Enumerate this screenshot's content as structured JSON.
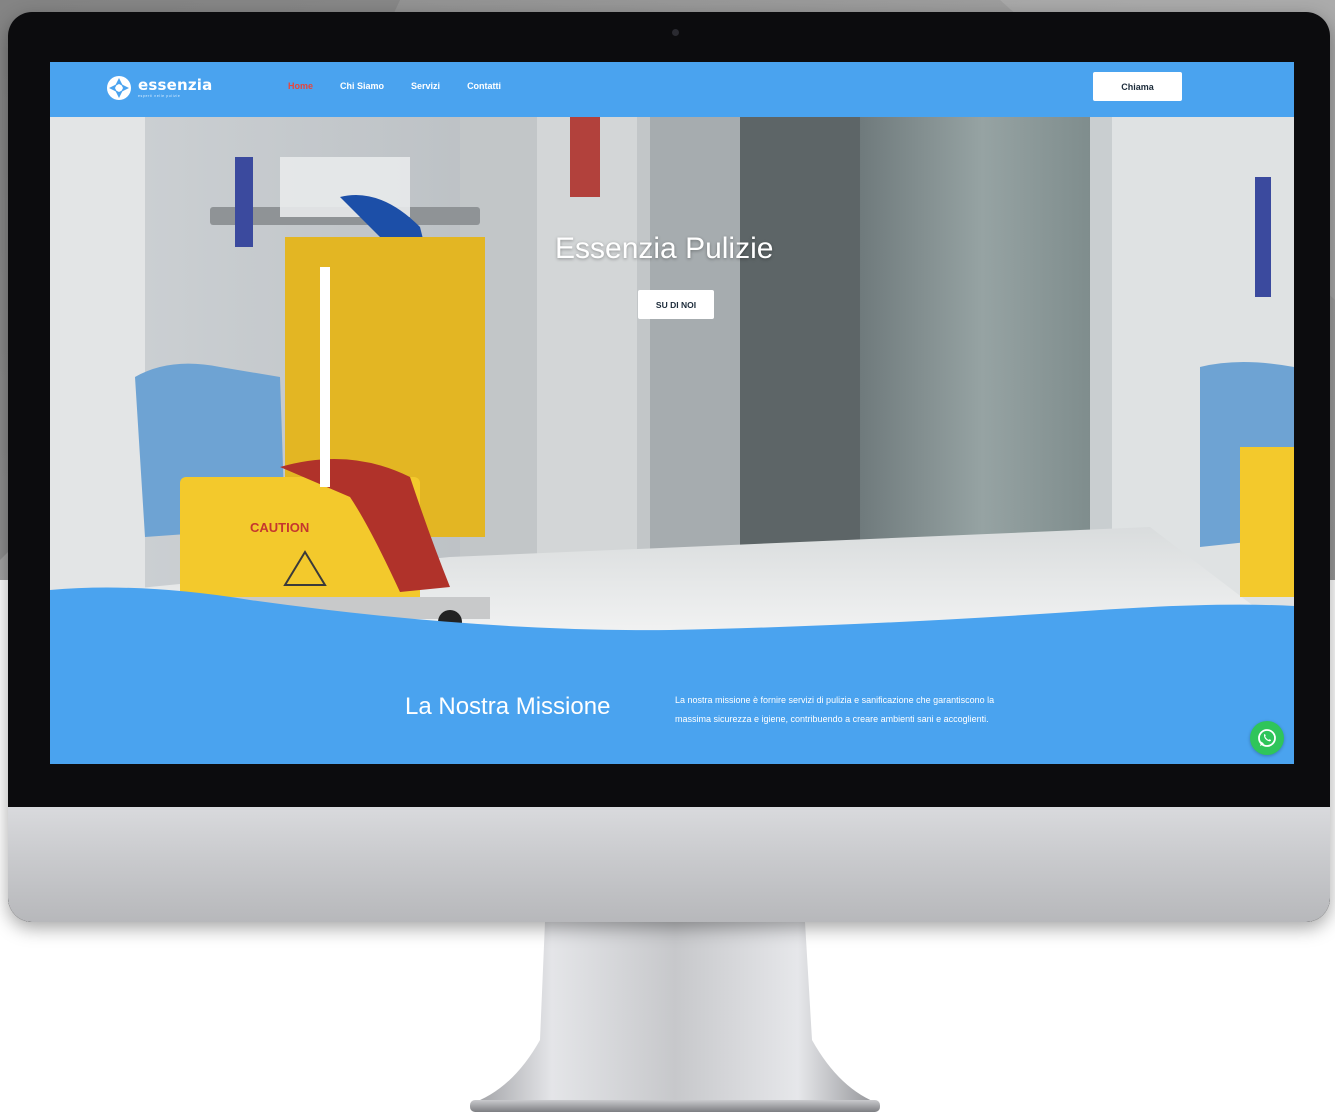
{
  "site": {
    "logo_text": "essenzia",
    "logo_tagline": "esperti nelle pulizie"
  },
  "nav": {
    "items": [
      {
        "label": "Home",
        "active": true
      },
      {
        "label": "Chi Siamo",
        "active": false
      },
      {
        "label": "Servizi",
        "active": false
      },
      {
        "label": "Contatti",
        "active": false
      }
    ],
    "call_label": "Chiama"
  },
  "hero": {
    "title": "Essenzia Pulizie",
    "button_label": "SU DI NOI",
    "photo_sign_text": "CAUTION"
  },
  "mission": {
    "title": "La Nostra Missione",
    "text": "La nostra missione è fornire servizi di pulizia e sanificazione che garantiscono la massima sicurezza e igiene, contribuendo a creare ambienti sani e accoglienti."
  },
  "icons": {
    "logo": "essenzia-logo-icon",
    "chat": "whatsapp-icon"
  },
  "colors": {
    "brand_blue": "#4aa3ef",
    "active_nav": "#e8453c",
    "whatsapp_green": "#2fc55a",
    "button_bg": "#ffffff"
  }
}
